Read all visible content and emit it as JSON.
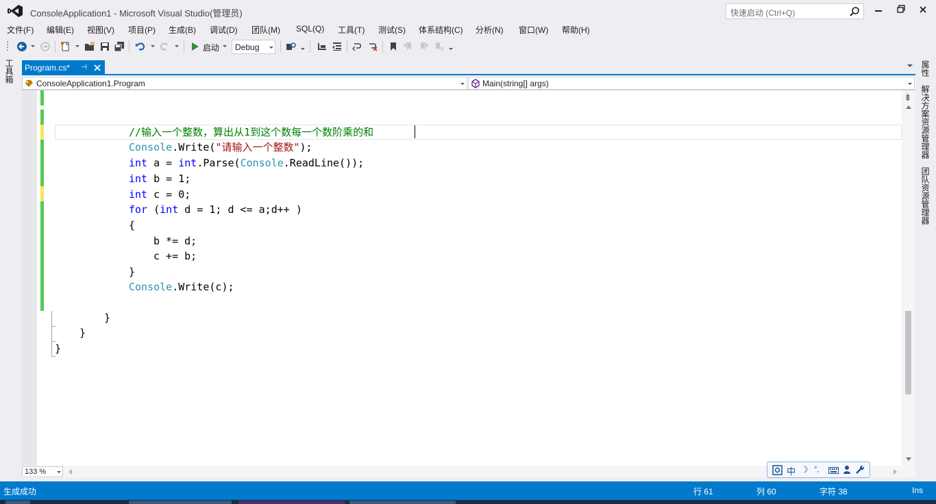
{
  "window": {
    "title": "ConsoleApplication1 - Microsoft Visual Studio(管理员)",
    "quick_launch_placeholder": "快速启动 (Ctrl+Q)"
  },
  "menu": [
    "文件(F)",
    "编辑(E)",
    "视图(V)",
    "项目(P)",
    "生成(B)",
    "调试(D)",
    "团队(M)",
    "SQL(Q)",
    "工具(T)",
    "测试(S)",
    "体系结构(C)",
    "分析(N)",
    "窗口(W)",
    "帮助(H)"
  ],
  "toolbar": {
    "start_label": "启动",
    "configuration": "Debug"
  },
  "side_tabs": {
    "left": "工具箱",
    "right": [
      "属性",
      "解决方案资源管理器",
      "团队资源管理器"
    ]
  },
  "document_tab": {
    "label": "Program.cs*"
  },
  "navigation": {
    "type_selector": "ConsoleApplication1.Program",
    "member_selector": "Main(string[] args)"
  },
  "code": {
    "comment": "//输入一个整数，算出从1到这个数每一个数阶乘的和",
    "write_prompt": {
      "type": "Console",
      "call": ".Write(",
      "string": "\"请输入一个整数\"",
      "end": ");"
    },
    "decl_a": {
      "kw": "int",
      "mid": " a = ",
      "kw2": "int",
      "call": ".Parse(",
      "type": "Console",
      "end": ".ReadLine());"
    },
    "decl_b": {
      "kw": "int",
      "rest": " b = 1;"
    },
    "decl_c": {
      "kw": "int",
      "rest": " c = 0;"
    },
    "for_loop": {
      "kw": "for",
      "open": " (",
      "kw2": "int",
      "rest": " d = 1; d <= a;d++ )"
    },
    "open_brace": "{",
    "body_1": "b *= d;",
    "body_2": "c += b;",
    "close_brace": "}",
    "write_c": {
      "type": "Console",
      "rest": ".Write(c);"
    },
    "close_method": "}",
    "close_class": "}",
    "close_namespace": "}"
  },
  "editor_footer": {
    "zoom": "133 %"
  },
  "ime": [
    "中"
  ],
  "status": {
    "message": "生成成功",
    "line": "行 61",
    "column": "列 60",
    "char": "字符 38",
    "mode": "Ins"
  },
  "colors": {
    "accent": "#007acc",
    "keyword": "#0000ff",
    "type": "#2b91af",
    "comment": "#008000",
    "string": "#a31515",
    "saved_change": "#57c857",
    "unsaved_change": "#f3e85b"
  }
}
